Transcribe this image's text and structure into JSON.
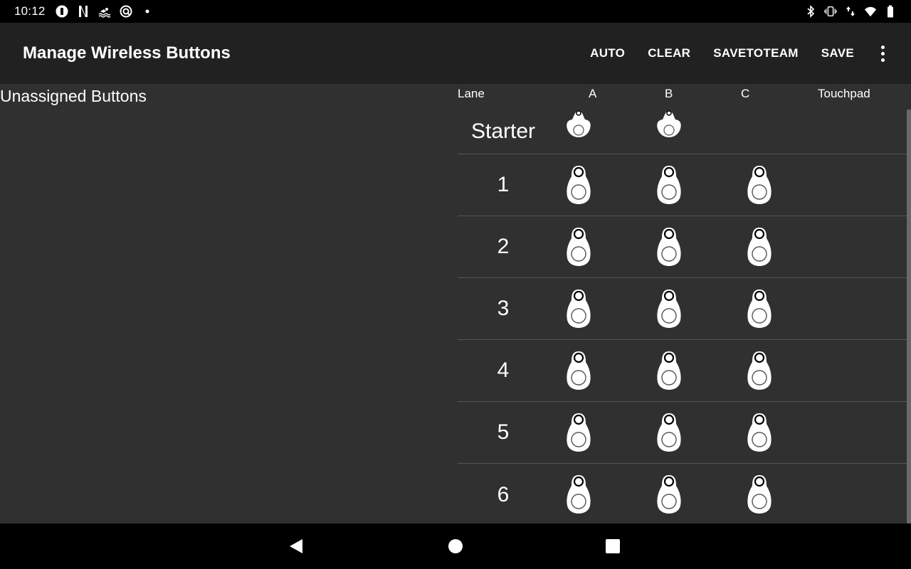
{
  "status_bar": {
    "time": "10:12",
    "left_icons": [
      "adblock-icon",
      "netflix-icon",
      "swim-icon",
      "vpn-icon",
      "dot-icon"
    ],
    "right_icons": [
      "bluetooth-icon",
      "vibrate-icon",
      "data-arrows-icon",
      "wifi-icon",
      "battery-icon"
    ]
  },
  "appbar": {
    "title": "Manage Wireless Buttons",
    "actions": {
      "auto": "AUTO",
      "clear": "CLEAR",
      "savetoteam": "SAVETOTEAM",
      "save": "SAVE"
    }
  },
  "unassigned": {
    "heading": "Unassigned Buttons"
  },
  "grid": {
    "headers": {
      "lane": "Lane",
      "a": "A",
      "b": "B",
      "c": "C",
      "touchpad": "Touchpad"
    },
    "rows": [
      {
        "lane": "Starter",
        "slots": [
          "A",
          "B"
        ]
      },
      {
        "lane": "1",
        "slots": [
          "A",
          "B",
          "C"
        ]
      },
      {
        "lane": "2",
        "slots": [
          "A",
          "B",
          "C"
        ]
      },
      {
        "lane": "3",
        "slots": [
          "A",
          "B",
          "C"
        ]
      },
      {
        "lane": "4",
        "slots": [
          "A",
          "B",
          "C"
        ]
      },
      {
        "lane": "5",
        "slots": [
          "A",
          "B",
          "C"
        ]
      },
      {
        "lane": "6",
        "slots": [
          "A",
          "B",
          "C"
        ]
      }
    ]
  },
  "colors": {
    "background": "#303030",
    "appbar": "#212121",
    "divider": "#555555",
    "button_icon": "#ffffff"
  }
}
